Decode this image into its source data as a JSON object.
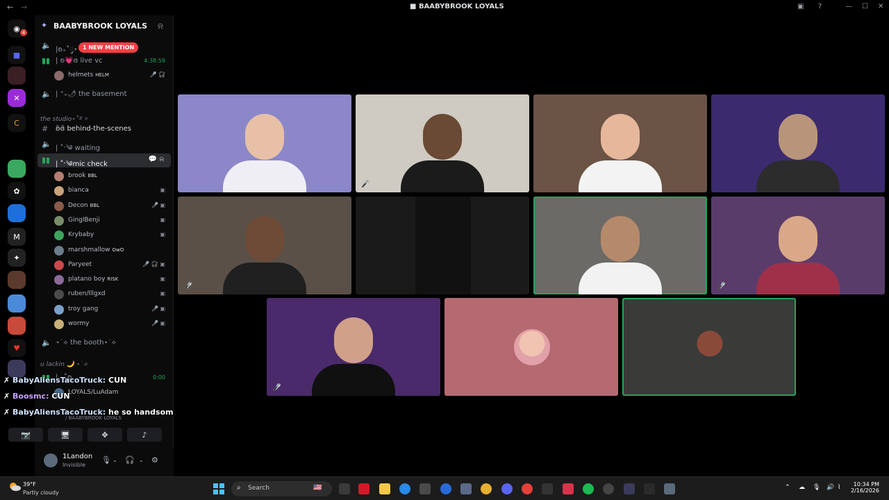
{
  "window": {
    "title": "BAABYBROOK LOYALS"
  },
  "server": {
    "name": "BAABYBROOK LOYALS"
  },
  "mention_pill": "1 NEW MENTION",
  "channels": {
    "top_voice": {
      "label": "|ʚ₊˚༘⋆",
      "kind": "voice"
    },
    "live_vc": {
      "label": "| ʚ💗ɞ live vc",
      "timer": "4:38:59"
    },
    "live_vc_user": {
      "name": "helmets",
      "tag": "HELM"
    },
    "basement": {
      "label": "| ⁺₊🌶 the basement"
    },
    "category_studio": "the studio⋆˚࿔ ✧",
    "behind": {
      "label": "ʚ̈ɞ̈ behind-the-scenes"
    },
    "waiting": {
      "label": "| ˚ˑ༄ waiting"
    },
    "mic_check": {
      "label": "| ˚ˑ༄mic check"
    },
    "booth": {
      "label": "⋆˙⟡ the booth⋆˙⟡"
    },
    "category_lackin": "u lackin 🌙 ⋆˙⟡",
    "bottom_voice": {
      "label": "| ₊˚ʚ",
      "timer": "0:00"
    },
    "bottom_user": {
      "name": "LOYALS/LuAdam"
    }
  },
  "mic_check_users": [
    {
      "name": "brook",
      "tag": "BBL",
      "color": "#b38072"
    },
    {
      "name": "bianca",
      "tag": "",
      "color": "#c9a37a"
    },
    {
      "name": "Decon",
      "tag": "BBL",
      "color": "#8a5a4a"
    },
    {
      "name": "GinglBenji",
      "tag": "",
      "color": "#7a8b6a"
    },
    {
      "name": "Krybaby",
      "tag": "",
      "color": "#3ba55c"
    },
    {
      "name": "marshmallow",
      "tag": "OwO",
      "color": "#6a7d8c"
    },
    {
      "name": "Paryeet",
      "tag": "",
      "color": "#c94a4a"
    },
    {
      "name": "platano boy",
      "tag": "RISK",
      "color": "#8a6a9a"
    },
    {
      "name": "ruben/lllgxd",
      "tag": "",
      "color": "#4a4a4a"
    },
    {
      "name": "troy gang",
      "tag": "",
      "color": "#7aa0c8"
    },
    {
      "name": "wormy",
      "tag": "",
      "color": "#c8b07a"
    }
  ],
  "overlay_messages": [
    {
      "who": "BabyAliensTacoTruck:",
      "text": "CUN"
    },
    {
      "who": "Boosmc:",
      "text": "CUN"
    },
    {
      "who": "BabyAliensTacoTruck:",
      "text": "he so handsome"
    }
  ],
  "voice_footer": {
    "sub": "/ BAABYBROOK LOYALS"
  },
  "user_panel": {
    "name": "1Landon",
    "status": "Invisible"
  },
  "tiles": [
    {
      "bg": "#8b87c8",
      "skin": "#e8c0a8",
      "shirt": "#f0eef5",
      "muted": false
    },
    {
      "bg": "#cfcac2",
      "skin": "#6a4a34",
      "shirt": "#1b1b1b",
      "muted": true
    },
    {
      "bg": "#6b5346",
      "skin": "#e6b79a",
      "shirt": "#f3f3f3",
      "muted": false
    },
    {
      "bg": "#3b2a6e",
      "skin": "#b8957a",
      "shirt": "#2c2c2c",
      "muted": false
    },
    {
      "bg": "#5a5048",
      "skin": "#6e4b36",
      "shirt": "#202020",
      "muted": true
    },
    {
      "bg": "#1a1a1a",
      "skin": "#2a2a2a",
      "shirt": "#1a1a1a",
      "muted": false
    },
    {
      "bg": "#6b6a66",
      "skin": "#b58a6b",
      "shirt": "#f2f2f2",
      "muted": false
    },
    {
      "bg": "#5a3c6a",
      "skin": "#d8a888",
      "shirt": "#a0304a",
      "muted": true
    },
    {
      "bg": "#4a2a6a",
      "skin": "#d0a088",
      "shirt": "#101010",
      "muted": true
    },
    {
      "bg": "#b56a72",
      "skin": "#f0c4b0",
      "shirt": "#e2a0a8",
      "muted": false
    },
    {
      "bg": "#3a3a38",
      "skin": "#8a4a3a",
      "shirt": "#3a3a38",
      "muted": false
    }
  ],
  "taskbar": {
    "temp": "39°F",
    "condition": "Partly cloudy",
    "search_placeholder": "Search",
    "time": "10:34 PM",
    "date": "2/16/2026"
  },
  "colors": {
    "speaking": "#23a559",
    "mention": "#f23f43",
    "blurple": "#5865f2"
  }
}
